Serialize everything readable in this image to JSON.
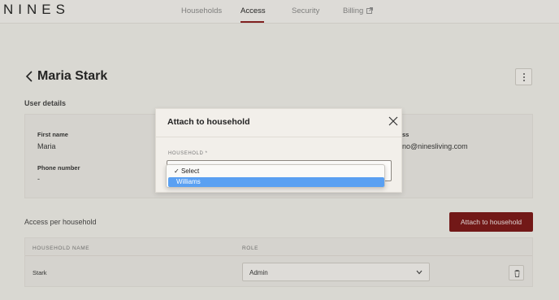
{
  "brand": {
    "logo": "NINES"
  },
  "nav": {
    "tabs": [
      {
        "label": "Households"
      },
      {
        "label": "Access"
      },
      {
        "label": "Security"
      },
      {
        "label": "Billing"
      }
    ],
    "active": "Access"
  },
  "user": {
    "name": "Maria Stark"
  },
  "details": {
    "section_title": "User details",
    "first_name_label": "First name",
    "first_name": "Maria",
    "phone_label": "Phone number",
    "phone": "-",
    "email_label_partial": "ss",
    "email_partial": "no@ninesliving.com"
  },
  "access": {
    "section_title": "Access per household",
    "attach_button": "Attach to household",
    "columns": [
      "HOUSEHOLD NAME",
      "ROLE"
    ],
    "rows": [
      {
        "household": "Stark",
        "role": "Admin"
      }
    ]
  },
  "modal": {
    "title": "Attach to household",
    "field_label": "HOUSEHOLD *",
    "options": [
      "Select",
      "Williams"
    ],
    "selected": "Select",
    "highlighted": "Williams"
  },
  "colors": {
    "accent": "#7a1414",
    "highlight": "#5aa0f2",
    "background": "#f0eee9"
  }
}
